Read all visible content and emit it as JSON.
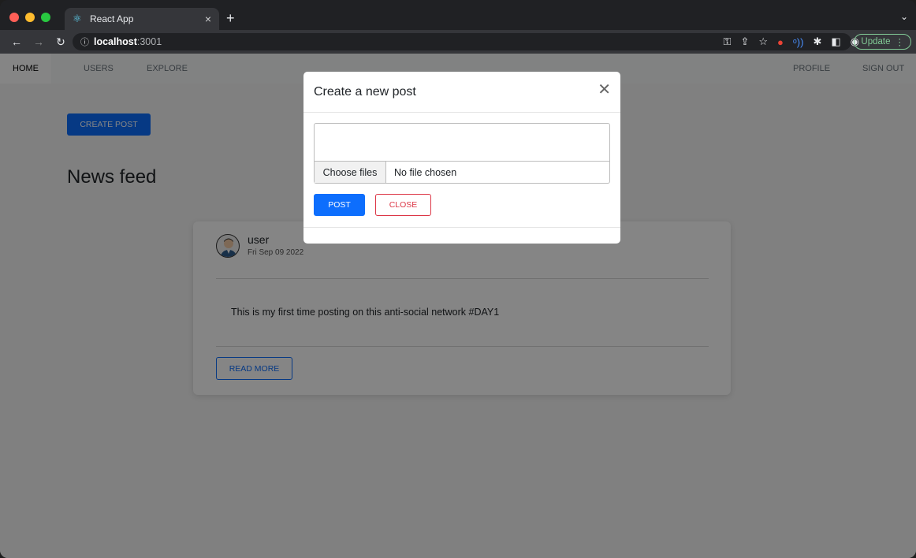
{
  "browser": {
    "tab_title": "React App",
    "tab_close": "×",
    "new_tab": "+",
    "tab_menu": "⌄",
    "url_host": "localhost",
    "url_port": ":3001",
    "update_label": "Update",
    "colors": {
      "light_red": "#ff5f57",
      "light_yellow": "#febc2e",
      "light_green": "#28c840",
      "update": "#81c995"
    }
  },
  "navbar": {
    "home": "HOME",
    "users": "USERS",
    "explore": "EXPLORE",
    "profile": "PROFILE",
    "sign_out": "SIGN OUT"
  },
  "main": {
    "create_post_label": "CREATE POST",
    "feed_title": "News feed"
  },
  "post": {
    "author": "user",
    "date": "Fri Sep 09 2022",
    "content": "This is my first time posting on this anti-social network #DAY1",
    "read_more_label": "READ MORE"
  },
  "modal": {
    "title": "Create a new post",
    "close_icon": "✕",
    "textarea_value": "",
    "choose_files_label": "Choose files",
    "file_status": "No file chosen",
    "post_label": "POST",
    "close_label": "CLOSE"
  },
  "colors": {
    "primary": "#0d6efd",
    "danger": "#dc3545"
  }
}
